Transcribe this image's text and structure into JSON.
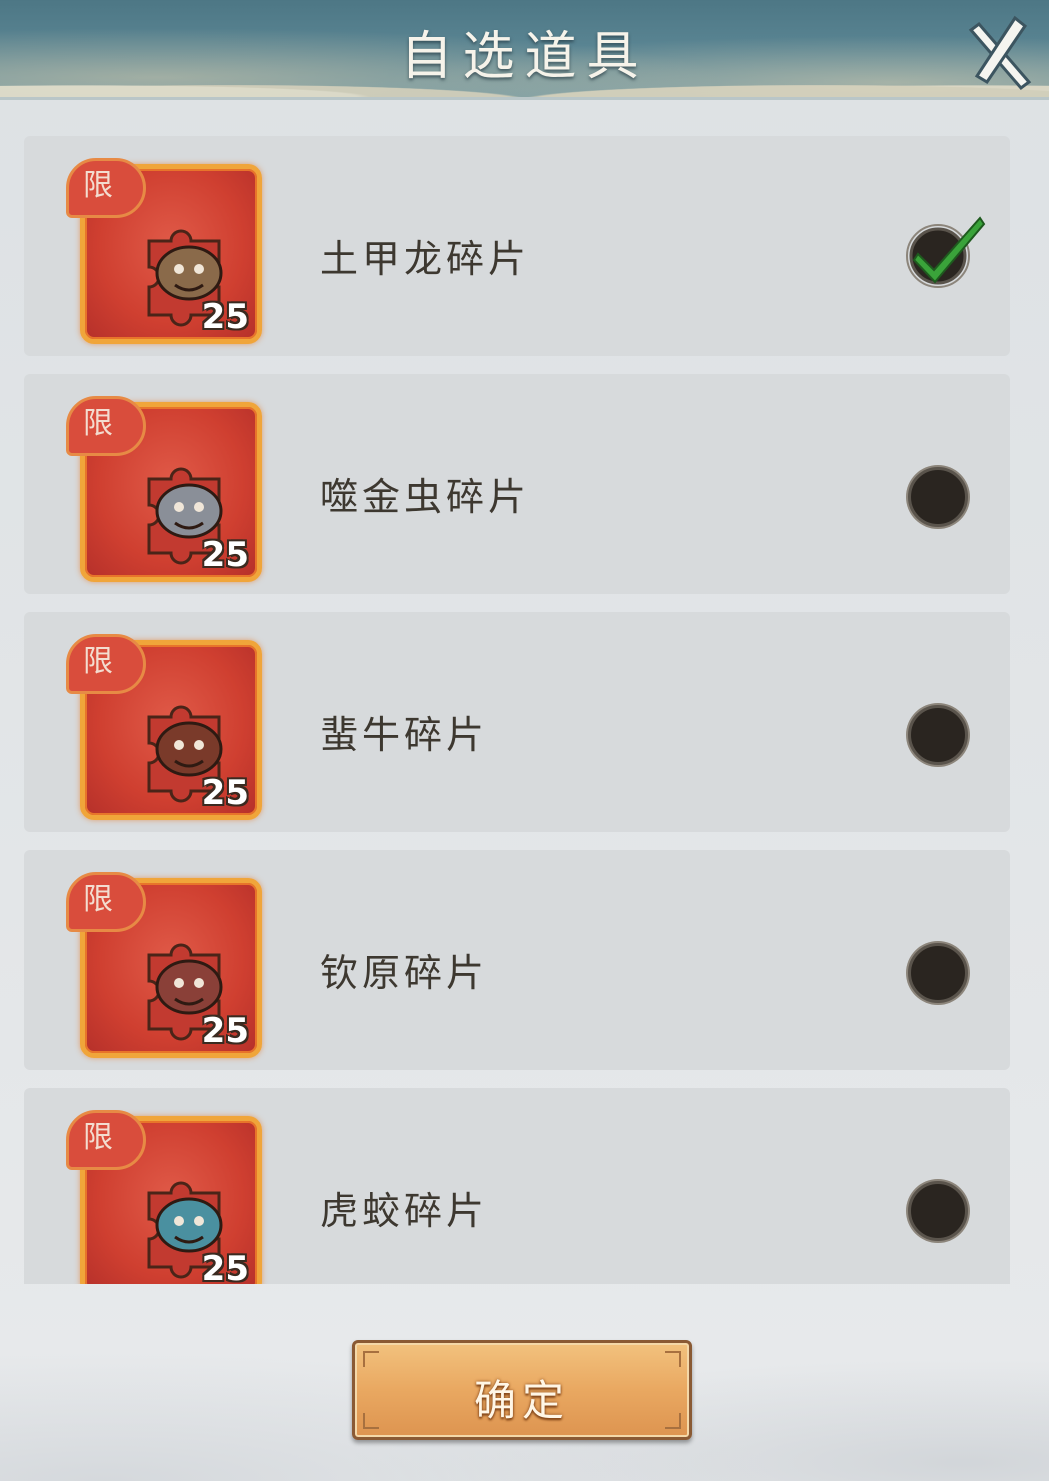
{
  "header": {
    "title": "自选道具"
  },
  "items": [
    {
      "name": "土甲龙碎片",
      "tag": "限",
      "quantity": "25",
      "selected": true
    },
    {
      "name": "噬金虫碎片",
      "tag": "限",
      "quantity": "25",
      "selected": false
    },
    {
      "name": "蜚牛碎片",
      "tag": "限",
      "quantity": "25",
      "selected": false
    },
    {
      "name": "钦原碎片",
      "tag": "限",
      "quantity": "25",
      "selected": false
    },
    {
      "name": "虎蛟碎片",
      "tag": "限",
      "quantity": "25",
      "selected": false
    }
  ],
  "footer": {
    "confirm_label": "确定"
  },
  "colors": {
    "accent_check": "#3aa33a",
    "card_red": "#cf3f30",
    "card_border": "#f0a53a",
    "header_teal": "#5b8694",
    "button_gold": "#e9a861"
  }
}
